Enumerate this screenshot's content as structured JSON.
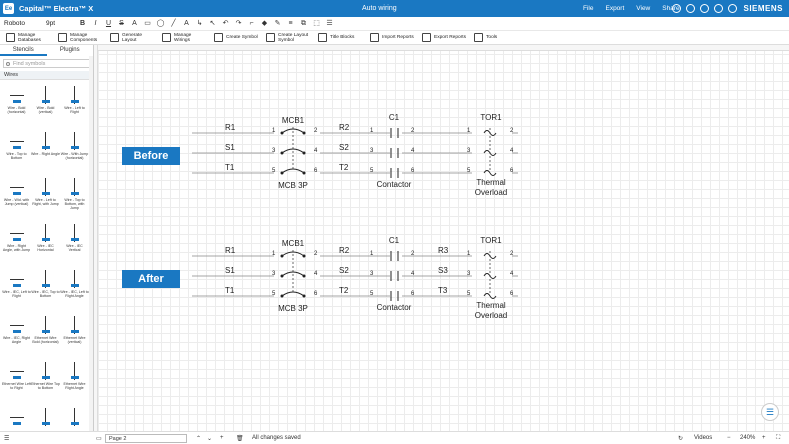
{
  "app": {
    "name": "Capital™ Electra™ X",
    "logo_text": "Ee",
    "doc_title": "Auto wiring",
    "brand": "SIEMENS",
    "menu": [
      "File",
      "Export",
      "View",
      "Share"
    ]
  },
  "toolbar1": {
    "font": "Roboto",
    "size": "9pt"
  },
  "toolbar2": [
    {
      "label": "Manage Databases"
    },
    {
      "label": "Manage Components"
    },
    {
      "label": "Generate Layout"
    },
    {
      "label": "Manage Wirings"
    },
    {
      "label": "Create Symbol"
    },
    {
      "label": "Create Layout Symbol"
    },
    {
      "label": "Title Blocks"
    },
    {
      "label": "Import Reports"
    },
    {
      "label": "Export Reports"
    },
    {
      "label": "Tools"
    }
  ],
  "panel": {
    "tab_stencils": "Stencils",
    "tab_plugins": "Plugins",
    "search_placeholder": "Find symbols",
    "section": "Wires",
    "stencils": [
      "Wire - Bold (horizontal)",
      "Wire - Bold (vertical)",
      "Wire - Left to Right",
      "Wire - Top to Bottom",
      "Wire - Right Angle",
      "Wire - With Jump (horizontal)",
      "Wire - Wid. with Jump (vertical)",
      "Wire - Left to Right, with Jump",
      "Wire - Top to Bottom, with Jump",
      "Wire - Right Angle, with Jump",
      "Wire - IEC Horizontal",
      "Wire - IEC Vertical",
      "Wire - IEC, Left to Right",
      "Wire - IEC, Top to Bottom",
      "Wire - IEC, Left to Right Angle",
      "Wire - IEC, Right Angle",
      "Ethernet Wire Bold (horizontal)",
      "Ethernet Wire (vertical)",
      "Ethernet Wire Left to Right",
      "Ethernet Wire Top to Bottom",
      "Ethernet Wire Right Angle",
      "",
      "",
      ""
    ]
  },
  "diagram": {
    "before_label": "Before",
    "after_label": "After",
    "before": {
      "inputs": [
        "R1",
        "S1",
        "T1"
      ],
      "mcb_title": "MCB1",
      "mcb_caption": "MCB 3P",
      "mcb_pins_left": [
        "1",
        "3",
        "5"
      ],
      "mcb_pins_right": [
        "2",
        "4",
        "6"
      ],
      "mid": [
        "R2",
        "S2",
        "T2"
      ],
      "contactor_title": "C1",
      "contactor_caption": "Contactor",
      "con_pins_left": [
        "1",
        "3",
        "5"
      ],
      "con_pins_right": [
        "2",
        "4",
        "6"
      ],
      "tor_title": "TOR1",
      "tor_caption_1": "Thermal",
      "tor_caption_2": "Overload",
      "tor_pins_left": [
        "1",
        "3",
        "5"
      ],
      "tor_pins_right": [
        "2",
        "4",
        "6"
      ],
      "out": []
    },
    "after": {
      "inputs": [
        "R1",
        "S1",
        "T1"
      ],
      "mcb_title": "MCB1",
      "mcb_caption": "MCB 3P",
      "mcb_pins_left": [
        "1",
        "3",
        "5"
      ],
      "mcb_pins_right": [
        "2",
        "4",
        "6"
      ],
      "mid": [
        "R2",
        "S2",
        "T2"
      ],
      "contactor_title": "C1",
      "contactor_caption": "Contactor",
      "con_pins_left": [
        "1",
        "3",
        "5"
      ],
      "con_pins_right": [
        "2",
        "4",
        "6"
      ],
      "tor_title": "TOR1",
      "tor_caption_1": "Thermal",
      "tor_caption_2": "Overload",
      "tor_pins_left": [
        "1",
        "3",
        "5"
      ],
      "tor_pins_right": [
        "2",
        "4",
        "6"
      ],
      "out": [
        "R3",
        "S3",
        "T3"
      ]
    }
  },
  "status": {
    "page": "Page 2",
    "saved": "All changes saved",
    "videos": "Videos",
    "zoom": "240%"
  }
}
